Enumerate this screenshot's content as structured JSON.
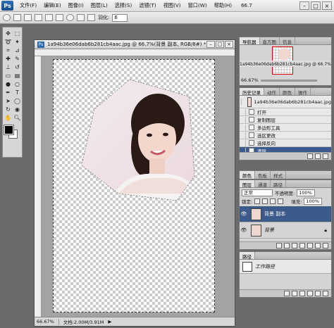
{
  "menubar": {
    "logo": "Ps",
    "items": [
      "文件(F)",
      "编辑(E)",
      "图像(I)",
      "图层(L)",
      "选择(S)",
      "滤镜(T)",
      "视图(V)",
      "窗口(W)",
      "帮助(H)"
    ],
    "zoom": "66.7",
    "window_buttons": [
      "–",
      "□",
      "×"
    ]
  },
  "options": {
    "feather_label": "羽化:",
    "feather_value": "6"
  },
  "document": {
    "title": "1a94b36e06dab6b281cb4aac.jpg @ 66.7%(背景 副本, RGB/8#) *",
    "status_zoom": "66.67%",
    "status_doc": "文档:2.00M/3.91M"
  },
  "navigator": {
    "tabs": [
      "导航器",
      "直方图",
      "信息"
    ],
    "file_label": "1a94b36e06dab6b281cb4aac.jpg @ 66.7%(背景 副本, R",
    "zoom": "66.67%"
  },
  "history": {
    "tabs": [
      "历史记录",
      "动作",
      "颜色",
      "操作"
    ],
    "snapshot": "1a94b36e06dab6b281cb4aac.jpg",
    "items": [
      "打开",
      "复制图层",
      "多边形工具",
      "选区更改",
      "选择反向",
      "清除"
    ],
    "selected_index": 5
  },
  "color_panel": {
    "tabs": [
      "颜色",
      "色板",
      "样式"
    ]
  },
  "layers": {
    "tabs": [
      "图层",
      "通道",
      "路径"
    ],
    "blend_mode": "正常",
    "opacity_label": "不透明度:",
    "opacity": "100%",
    "lock_label": "锁定:",
    "fill_label": "填充:",
    "fill": "100%",
    "items": [
      {
        "name": "背景 副本",
        "selected": true
      },
      {
        "name": "背景",
        "selected": false
      }
    ]
  },
  "paths": {
    "tabs": [
      "路径"
    ],
    "items": [
      "工作路径"
    ]
  },
  "colors": {
    "selection": "#3b5a8d",
    "canvas_checker": "#cccccc"
  }
}
